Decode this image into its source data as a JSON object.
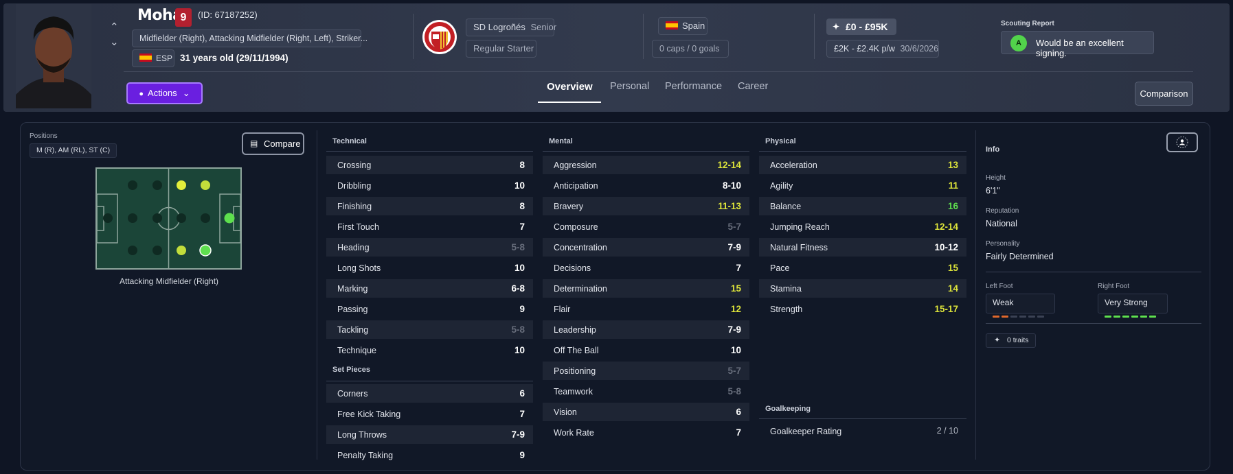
{
  "player": {
    "name": "Moha",
    "number": "9",
    "id_text": "(ID: 67187252)",
    "positions_full": "Midfielder (Right), Attacking Midfielder (Right, Left), Striker...",
    "nationality_code": "ESP",
    "age_text": "31 years old (29/11/1994)"
  },
  "club": {
    "name": "SD Logroñés",
    "level": "Senior",
    "role": "Regular Starter"
  },
  "nation": {
    "name": "Spain",
    "caps": "0 caps / 0 goals"
  },
  "value": {
    "range": "£0 - £95K",
    "wage": "£2K - £2.4K p/w",
    "contract_end": "30/6/2026"
  },
  "scouting": {
    "title": "Scouting Report",
    "grade": "A",
    "text": "Would be an excellent signing."
  },
  "actions_label": "Actions",
  "tabs": [
    {
      "label": "Overview",
      "active": true
    },
    {
      "label": "Personal",
      "active": false
    },
    {
      "label": "Performance",
      "active": false
    },
    {
      "label": "Career",
      "active": false
    }
  ],
  "comparison_label": "Comparison",
  "positions_panel": {
    "title": "Positions",
    "chip": "M (R), AM (RL), ST (C)",
    "compare_label": "Compare",
    "caption": "Attacking Midfielder (Right)"
  },
  "technical": {
    "title": "Technical",
    "items": [
      {
        "name": "Crossing",
        "value": "8",
        "tone": "white"
      },
      {
        "name": "Dribbling",
        "value": "10",
        "tone": "white"
      },
      {
        "name": "Finishing",
        "value": "8",
        "tone": "white"
      },
      {
        "name": "First Touch",
        "value": "7",
        "tone": "white"
      },
      {
        "name": "Heading",
        "value": "5-8",
        "tone": "grey"
      },
      {
        "name": "Long Shots",
        "value": "10",
        "tone": "white"
      },
      {
        "name": "Marking",
        "value": "6-8",
        "tone": "white"
      },
      {
        "name": "Passing",
        "value": "9",
        "tone": "white"
      },
      {
        "name": "Tackling",
        "value": "5-8",
        "tone": "grey"
      },
      {
        "name": "Technique",
        "value": "10",
        "tone": "white"
      }
    ]
  },
  "set_pieces": {
    "title": "Set Pieces",
    "items": [
      {
        "name": "Corners",
        "value": "6",
        "tone": "white"
      },
      {
        "name": "Free Kick Taking",
        "value": "7",
        "tone": "white"
      },
      {
        "name": "Long Throws",
        "value": "7-9",
        "tone": "white"
      },
      {
        "name": "Penalty Taking",
        "value": "9",
        "tone": "white"
      }
    ]
  },
  "mental": {
    "title": "Mental",
    "items": [
      {
        "name": "Aggression",
        "value": "12-14",
        "tone": "yellow"
      },
      {
        "name": "Anticipation",
        "value": "8-10",
        "tone": "white"
      },
      {
        "name": "Bravery",
        "value": "11-13",
        "tone": "yellow"
      },
      {
        "name": "Composure",
        "value": "5-7",
        "tone": "grey"
      },
      {
        "name": "Concentration",
        "value": "7-9",
        "tone": "white"
      },
      {
        "name": "Decisions",
        "value": "7",
        "tone": "white"
      },
      {
        "name": "Determination",
        "value": "15",
        "tone": "yellow"
      },
      {
        "name": "Flair",
        "value": "12",
        "tone": "yellow"
      },
      {
        "name": "Leadership",
        "value": "7-9",
        "tone": "white"
      },
      {
        "name": "Off The Ball",
        "value": "10",
        "tone": "white"
      },
      {
        "name": "Positioning",
        "value": "5-7",
        "tone": "grey"
      },
      {
        "name": "Teamwork",
        "value": "5-8",
        "tone": "grey"
      },
      {
        "name": "Vision",
        "value": "6",
        "tone": "white"
      },
      {
        "name": "Work Rate",
        "value": "7",
        "tone": "white"
      }
    ]
  },
  "physical": {
    "title": "Physical",
    "items": [
      {
        "name": "Acceleration",
        "value": "13",
        "tone": "yellow"
      },
      {
        "name": "Agility",
        "value": "11",
        "tone": "yellow"
      },
      {
        "name": "Balance",
        "value": "16",
        "tone": "green"
      },
      {
        "name": "Jumping Reach",
        "value": "12-14",
        "tone": "yellow"
      },
      {
        "name": "Natural Fitness",
        "value": "10-12",
        "tone": "white"
      },
      {
        "name": "Pace",
        "value": "15",
        "tone": "yellow"
      },
      {
        "name": "Stamina",
        "value": "14",
        "tone": "yellow"
      },
      {
        "name": "Strength",
        "value": "15-17",
        "tone": "yellow"
      }
    ]
  },
  "goalkeeping": {
    "title": "Goalkeeping",
    "items": [
      {
        "name": "Goalkeeper Rating",
        "value": "2 / 10",
        "tone": "dim"
      }
    ]
  },
  "info": {
    "title": "Info",
    "height_label": "Height",
    "height": "6'1\"",
    "reputation_label": "Reputation",
    "reputation": "National",
    "personality_label": "Personality",
    "personality": "Fairly Determined",
    "left_foot_label": "Left Foot",
    "left_foot": "Weak",
    "left_foot_level": 2,
    "right_foot_label": "Right Foot",
    "right_foot": "Very Strong",
    "right_foot_level": 6,
    "traits": "0 traits"
  },
  "colors": {
    "accent": "#6a1fe0",
    "green": "#5ee04e",
    "yellow": "#dde43a",
    "grey": "#676d7b",
    "weak_foot": "#e0682b"
  }
}
